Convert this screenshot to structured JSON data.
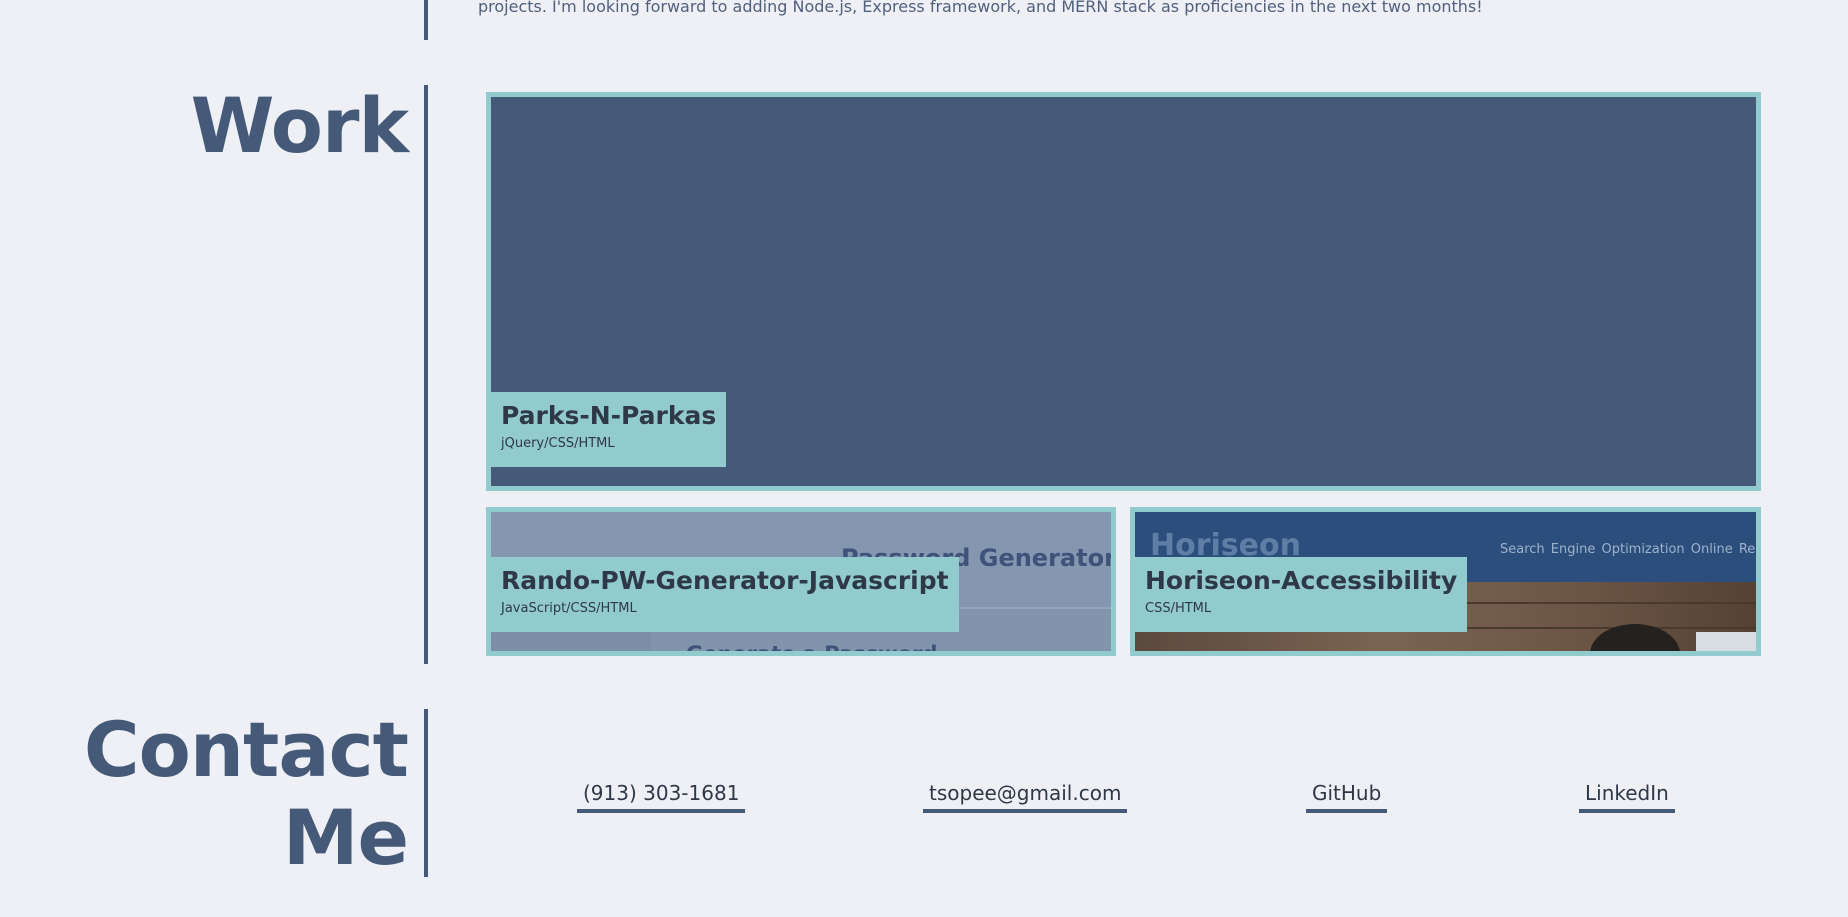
{
  "about": {
    "intro_tail": "projects. I'm looking forward to adding Node.js, Express framework, and MERN stack as proficiencies in the next two months!"
  },
  "work": {
    "title": "Work",
    "projects": [
      {
        "title": "Parks-N-Parkas",
        "tech": "jQuery/CSS/HTML"
      },
      {
        "title": "Rando-PW-Generator-Javascript",
        "tech": "JavaScript/CSS/HTML",
        "preview": {
          "heading": "Password Generator",
          "subheading": "Generate a Password"
        }
      },
      {
        "title": "Horiseon-Accessibility",
        "tech": "CSS/HTML",
        "preview": {
          "logo": "Horiseon",
          "nav": "Search Engine Optimization    Online Rep"
        }
      }
    ]
  },
  "contact": {
    "title_line1": "Contact",
    "title_line2": "Me",
    "links": {
      "phone": "(913) 303-1681",
      "email": "tsopee@gmail.com",
      "github": "GitHub",
      "linkedin": "LinkedIn"
    }
  },
  "colors": {
    "background": "#efeff6",
    "accent_navy": "#445a78",
    "accent_teal": "#91cbcd",
    "text_dark": "#2f3846"
  }
}
